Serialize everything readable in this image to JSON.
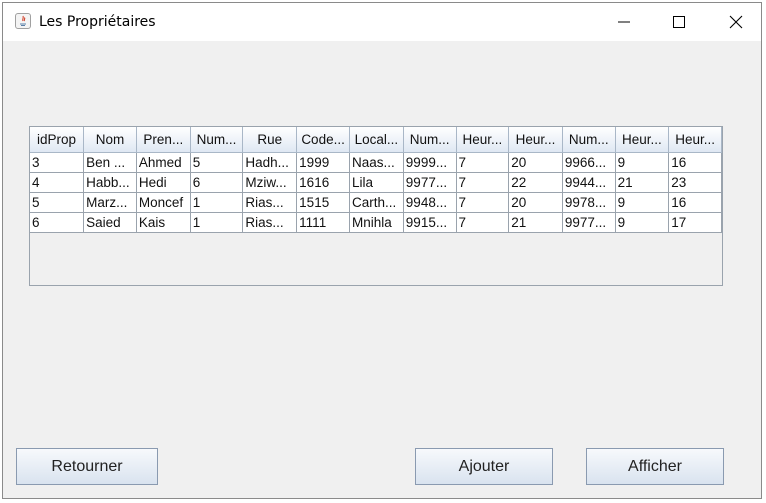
{
  "window": {
    "title": "Les Propriétaires"
  },
  "table": {
    "columns": [
      "idProp",
      "Nom",
      "Pren...",
      "Num...",
      "Rue",
      "Code...",
      "Local...",
      "Num...",
      "Heur...",
      "Heur...",
      "Num...",
      "Heur...",
      "Heur..."
    ],
    "rows": [
      [
        "3",
        "Ben ...",
        "Ahmed",
        "5",
        "Hadh...",
        "1999",
        "Naas...",
        "9999...",
        "7",
        "20",
        "9966...",
        "9",
        "16"
      ],
      [
        "4",
        "Habb...",
        "Hedi",
        "6",
        "Mziw...",
        "1616",
        "Lila",
        "9977...",
        "7",
        "22",
        "9944...",
        "21",
        "23"
      ],
      [
        "5",
        "Marz...",
        "Moncef",
        "1",
        "Rias...",
        "1515",
        "Carth...",
        "9948...",
        "7",
        "20",
        "9978...",
        "9",
        "16"
      ],
      [
        "6",
        "Saied",
        "Kais",
        "1",
        "Rias...",
        "1111",
        "Mnihla",
        "9915...",
        "7",
        "21",
        "9977...",
        "9",
        "17"
      ]
    ]
  },
  "buttons": {
    "retourner": "Retourner",
    "ajouter": "Ajouter",
    "afficher": "Afficher"
  }
}
